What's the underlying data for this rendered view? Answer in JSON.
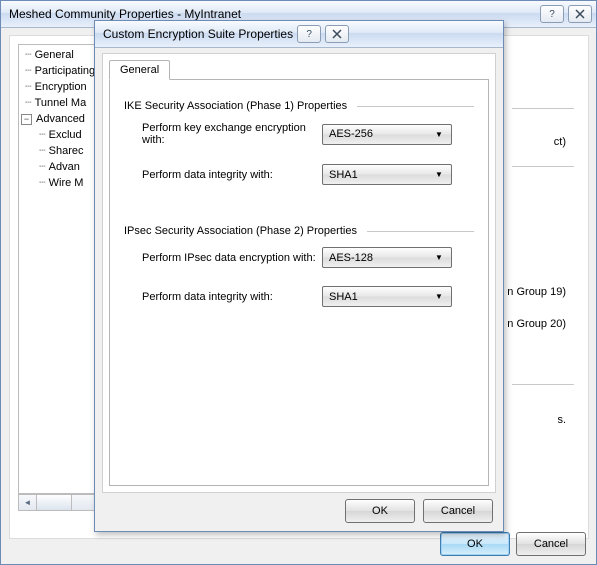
{
  "outer": {
    "title": "Meshed Community Properties - MyIntranet",
    "tree": {
      "items": [
        {
          "label": "General",
          "depth": 0
        },
        {
          "label": "Participating",
          "depth": 0
        },
        {
          "label": "Encryption",
          "depth": 0
        },
        {
          "label": "Tunnel Ma",
          "depth": 0
        },
        {
          "label": "Advanced",
          "depth": 0,
          "expanded": true
        },
        {
          "label": "Exclud",
          "depth": 1
        },
        {
          "label": "Sharec",
          "depth": 1
        },
        {
          "label": "Advan",
          "depth": 1
        },
        {
          "label": "Wire M",
          "depth": 1
        }
      ]
    },
    "rightFragments": {
      "f1": "ct)",
      "f2": "n Group 19)",
      "f3": "n Group 20)",
      "f4": "s."
    },
    "buttons": {
      "ok": "OK",
      "cancel": "Cancel"
    }
  },
  "modal": {
    "title": "Custom Encryption Suite Properties",
    "tab": "General",
    "phase1": {
      "header": "IKE Security Association (Phase 1) Properties",
      "encLabel": "Perform key exchange encryption with:",
      "encValue": "AES-256",
      "intLabel": "Perform data integrity with:",
      "intValue": "SHA1"
    },
    "phase2": {
      "header": "IPsec Security Association (Phase 2) Properties",
      "encLabel": "Perform IPsec data encryption with:",
      "encValue": "AES-128",
      "intLabel": "Perform data integrity with:",
      "intValue": "SHA1"
    },
    "buttons": {
      "ok": "OK",
      "cancel": "Cancel"
    }
  }
}
